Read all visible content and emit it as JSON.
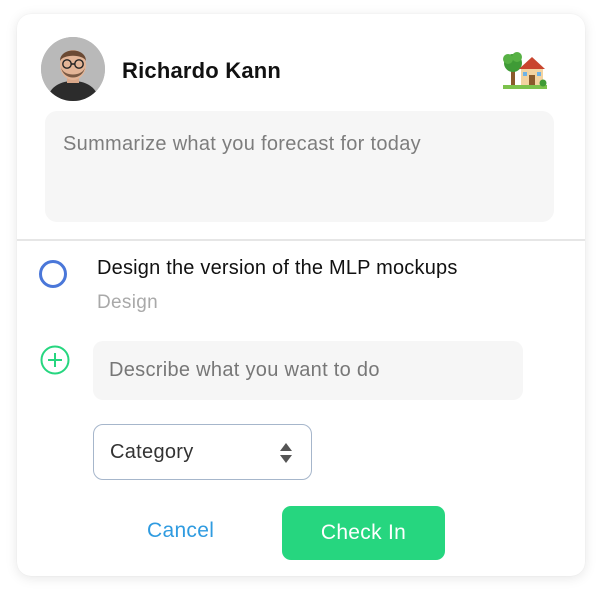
{
  "user": {
    "name": "Richardo Kann",
    "avatar_icon": "user-avatar-photo"
  },
  "header": {
    "status_icon": "house-with-garden-icon"
  },
  "forecast": {
    "value": "",
    "placeholder": "Summarize what you forecast for today"
  },
  "task": {
    "title": "Design the version of the MLP mockups",
    "category": "Design",
    "status_icon": "circle-outline-icon",
    "status_color": "#4a77d9"
  },
  "new_task": {
    "add_icon": "plus-circle-icon",
    "add_color": "#26d67f",
    "value": "",
    "placeholder": "Describe what you want to do",
    "category_label": "Category",
    "category_icon": "sort-arrows-icon"
  },
  "actions": {
    "cancel_label": "Cancel",
    "checkin_label": "Check In",
    "cancel_color": "#2f9be0",
    "checkin_color": "#26d67f"
  }
}
